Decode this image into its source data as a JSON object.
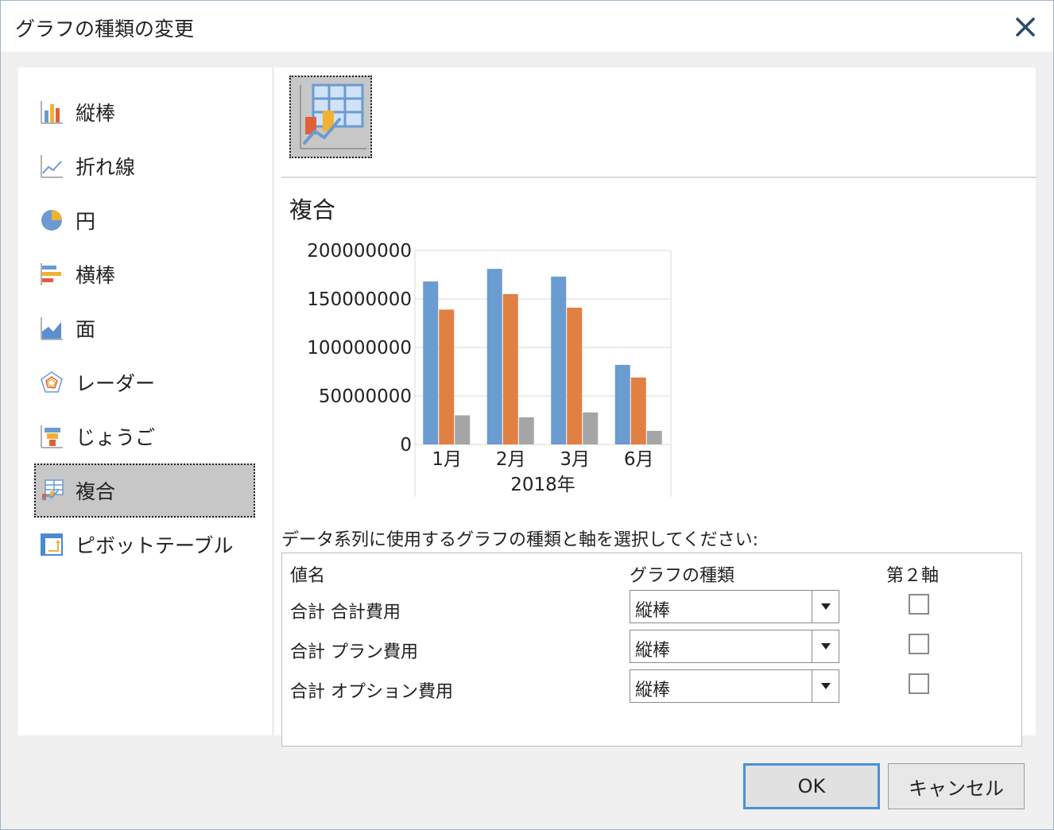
{
  "dialog": {
    "title": "グラフの種類の変更"
  },
  "chart_types": [
    {
      "label": "縦棒",
      "icon": "column-chart-icon"
    },
    {
      "label": "折れ線",
      "icon": "line-chart-icon"
    },
    {
      "label": "円",
      "icon": "pie-chart-icon"
    },
    {
      "label": "横棒",
      "icon": "bar-chart-icon"
    },
    {
      "label": "面",
      "icon": "area-chart-icon"
    },
    {
      "label": "レーダー",
      "icon": "radar-chart-icon"
    },
    {
      "label": "じょうご",
      "icon": "funnel-chart-icon"
    },
    {
      "label": "複合",
      "icon": "combo-chart-icon",
      "selected": true
    },
    {
      "label": "ピボットテーブル",
      "icon": "pivot-table-icon"
    }
  ],
  "preview": {
    "section_title": "複合",
    "instruction": "データ系列に使用するグラフの種類と軸を選択してください:"
  },
  "chart_data": {
    "type": "bar",
    "categories": [
      "1月",
      "2月",
      "3月",
      "6月"
    ],
    "group_label": "2018年",
    "series": [
      {
        "values": [
          168000000,
          181000000,
          173000000,
          82000000
        ],
        "color": "#6a9bd1"
      },
      {
        "values": [
          139000000,
          155000000,
          141000000,
          69000000
        ],
        "color": "#e08043"
      },
      {
        "values": [
          30000000,
          28000000,
          33000000,
          14000000
        ],
        "color": "#a5a5a5"
      }
    ],
    "ylim": [
      0,
      200000000
    ],
    "yticks": [
      "0",
      "50000000",
      "100000000",
      "150000000",
      "200000000"
    ],
    "grid": true
  },
  "series_table": {
    "headers": {
      "name": "値名",
      "chart_type": "グラフの種類",
      "secondary_axis": "第２軸"
    },
    "rows": [
      {
        "name": "合計 合計費用",
        "chart_type": "縦棒",
        "secondary": false
      },
      {
        "name": "合計 プラン費用",
        "chart_type": "縦棒",
        "secondary": false
      },
      {
        "name": "合計 オプション費用",
        "chart_type": "縦棒",
        "secondary": false
      }
    ]
  },
  "buttons": {
    "ok": "OK",
    "cancel": "キャンセル"
  }
}
